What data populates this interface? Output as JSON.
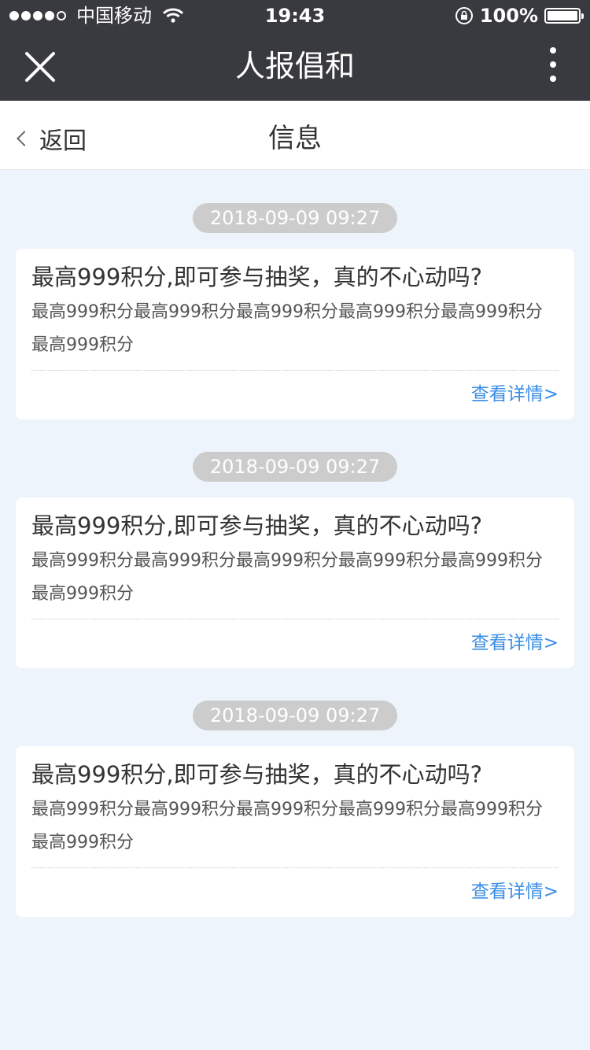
{
  "status_bar": {
    "carrier": "中国移动",
    "time": "19:43",
    "battery": "100%"
  },
  "app_bar": {
    "title": "人报倡和"
  },
  "page_header": {
    "back_label": "返回",
    "title": "信息"
  },
  "messages": [
    {
      "time": "2018-09-09 09:27",
      "title": "最高999积分,即可参与抽奖，真的不心动吗?",
      "body": "最高999积分最高999积分最高999积分最高999积分最高999积分最高999积分",
      "link": "查看详情>"
    },
    {
      "time": "2018-09-09 09:27",
      "title": "最高999积分,即可参与抽奖，真的不心动吗?",
      "body": "最高999积分最高999积分最高999积分最高999积分最高999积分最高999积分",
      "link": "查看详情>"
    },
    {
      "time": "2018-09-09 09:27",
      "title": "最高999积分,即可参与抽奖，真的不心动吗?",
      "body": "最高999积分最高999积分最高999积分最高999积分最高999积分最高999积分",
      "link": "查看详情>"
    }
  ]
}
